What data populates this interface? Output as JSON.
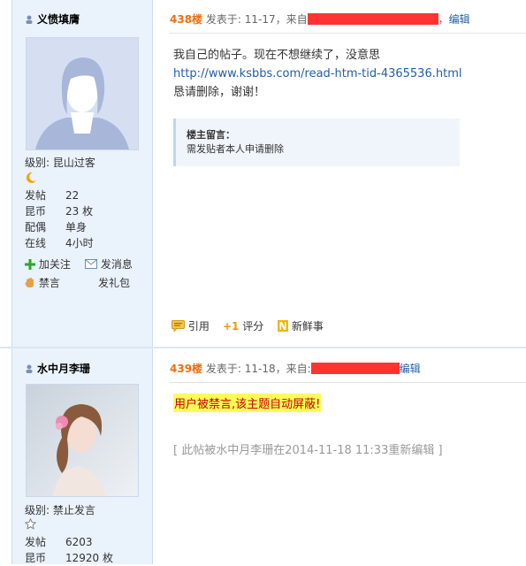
{
  "posts": [
    {
      "username": "义愤填膺",
      "level_label": "级别: 昆山过客",
      "stats": [
        {
          "k": "发帖",
          "v": "22"
        },
        {
          "k": "昆币",
          "v": "23 枚"
        },
        {
          "k": "配偶",
          "v": "单身"
        },
        {
          "k": "在线",
          "v": "4小时"
        }
      ],
      "actions": {
        "follow": "加关注",
        "message": "发消息",
        "ban": "禁言",
        "gift": "发礼包"
      },
      "floor": "438楼",
      "posted": "发表于: 11-17，来自",
      "edit": "编辑",
      "body_line1": "我自己的帖子。现在不想继续了，没意思",
      "body_link": "http://www.ksbbs.com/read-htm-tid-4365536.html",
      "body_line3": "恳请删除，谢谢！",
      "quote_title": "楼主留言：",
      "quote_text": "需发贴者本人申请删除",
      "foot": {
        "quote": "引用",
        "rate": "评分",
        "fresh": "新鲜事"
      }
    },
    {
      "username": "水中月李珊",
      "level_label": "级别: 禁止发言",
      "stats": [
        {
          "k": "发帖",
          "v": "6203"
        },
        {
          "k": "昆币",
          "v": "12920 枚"
        }
      ],
      "floor": "439楼",
      "posted": "发表于: 11-18，来自:",
      "edit": "编辑",
      "banned_text": "用户被禁言,该主题自动屏蔽!",
      "edit_note": "[ 此帖被水中月李珊在2014-11-18 11:33重新编辑 ]"
    }
  ],
  "colors": {
    "floor": "#f26c0c",
    "link": "#1f5fa8",
    "sidebar": "#eaf2fb"
  }
}
